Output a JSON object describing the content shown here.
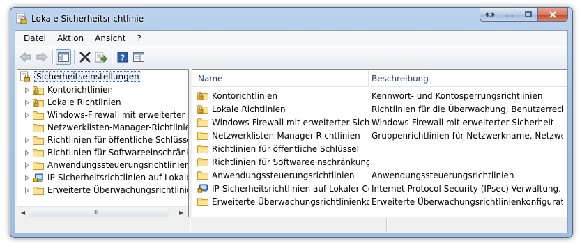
{
  "window": {
    "title": "Lokale Sicherheitsrichtlinie"
  },
  "menu": [
    "Datei",
    "Aktion",
    "Ansicht",
    "?"
  ],
  "toolbar": {
    "buttons": [
      "back-icon",
      "forward-icon",
      "show-tree-icon",
      "delete-icon",
      "export-list-icon",
      "help-icon",
      "properties-icon"
    ]
  },
  "tree": {
    "root": "Sicherheitseinstellungen",
    "items": [
      {
        "label": "Kontorichtlinien",
        "icon": "folder-lock-icon",
        "expandable": true
      },
      {
        "label": "Lokale Richtlinien",
        "icon": "folder-lock-icon",
        "expandable": true
      },
      {
        "label": "Windows-Firewall mit erweiterter Sicher",
        "icon": "folder-icon",
        "expandable": true
      },
      {
        "label": "Netzwerklisten-Manager-Richtlinien",
        "icon": "folder-icon",
        "expandable": false
      },
      {
        "label": "Richtlinien für öffentliche Schlüssel",
        "icon": "folder-icon",
        "expandable": true
      },
      {
        "label": "Richtlinien für Softwareeinschränkung",
        "icon": "folder-icon",
        "expandable": true
      },
      {
        "label": "Anwendungssteuerungsrichtlinien",
        "icon": "folder-icon",
        "expandable": true
      },
      {
        "label": "IP-Sicherheitsrichtlinien auf Lokaler C",
        "icon": "ipsec-icon",
        "expandable": true
      },
      {
        "label": "Erweiterte Überwachungsrichtlinienkonf",
        "icon": "folder-icon",
        "expandable": true
      }
    ],
    "scroll_grip": "III"
  },
  "list": {
    "columns": [
      "Name",
      "Beschreibung"
    ],
    "rows": [
      {
        "name": "Kontorichtlinien",
        "desc": "Kennwort- und Kontosperrungsrichtlinien",
        "icon": "folder-lock-icon"
      },
      {
        "name": "Lokale Richtlinien",
        "desc": "Richtlinien für die Überwachung, Benutzerrecht...",
        "icon": "folder-lock-icon"
      },
      {
        "name": "Windows-Firewall mit erweiterter Sicherh...",
        "desc": "Windows-Firewall mit erweiterter Sicherheit",
        "icon": "folder-icon"
      },
      {
        "name": "Netzwerklisten-Manager-Richtlinien",
        "desc": "Gruppenrichtlinien für Netzwerkname, Netzwer...",
        "icon": "folder-icon"
      },
      {
        "name": "Richtlinien für öffentliche Schlüssel",
        "desc": "",
        "icon": "folder-icon"
      },
      {
        "name": "Richtlinien für Softwareeinschränkung",
        "desc": "",
        "icon": "folder-icon"
      },
      {
        "name": "Anwendungssteuerungsrichtlinien",
        "desc": "Anwendungssteuerungsrichtlinien",
        "icon": "folder-icon"
      },
      {
        "name": "IP-Sicherheitsrichtlinien auf Lokaler Com...",
        "desc": "Internet Protocol Security (IPsec)-Verwaltung. ...",
        "icon": "ipsec-icon"
      },
      {
        "name": "Erweiterte Überwachungsrichtlinienkonfi...",
        "desc": "Erweiterte Überwachungsrichtlinienkonfigurati...",
        "icon": "folder-icon"
      }
    ]
  }
}
